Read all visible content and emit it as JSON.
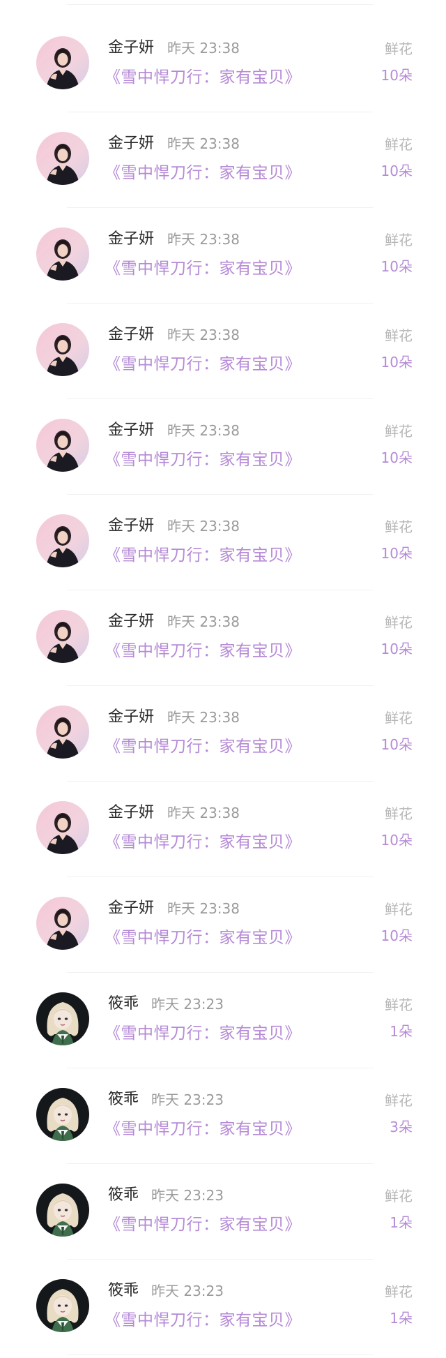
{
  "records": [
    {
      "avatar": "woman-portrait-pink-background",
      "user": "金子妍",
      "time": "昨天 23:38",
      "work": "《雪中悍刀行：家有宝贝》",
      "gift": "鲜花",
      "amount": "10朵"
    },
    {
      "avatar": "woman-portrait-pink-background",
      "user": "金子妍",
      "time": "昨天 23:38",
      "work": "《雪中悍刀行：家有宝贝》",
      "gift": "鲜花",
      "amount": "10朵"
    },
    {
      "avatar": "woman-portrait-pink-background",
      "user": "金子妍",
      "time": "昨天 23:38",
      "work": "《雪中悍刀行：家有宝贝》",
      "gift": "鲜花",
      "amount": "10朵"
    },
    {
      "avatar": "woman-portrait-pink-background",
      "user": "金子妍",
      "time": "昨天 23:38",
      "work": "《雪中悍刀行：家有宝贝》",
      "gift": "鲜花",
      "amount": "10朵"
    },
    {
      "avatar": "woman-portrait-pink-background",
      "user": "金子妍",
      "time": "昨天 23:38",
      "work": "《雪中悍刀行：家有宝贝》",
      "gift": "鲜花",
      "amount": "10朵"
    },
    {
      "avatar": "woman-portrait-pink-background",
      "user": "金子妍",
      "time": "昨天 23:38",
      "work": "《雪中悍刀行：家有宝贝》",
      "gift": "鲜花",
      "amount": "10朵"
    },
    {
      "avatar": "woman-portrait-pink-background",
      "user": "金子妍",
      "time": "昨天 23:38",
      "work": "《雪中悍刀行：家有宝贝》",
      "gift": "鲜花",
      "amount": "10朵"
    },
    {
      "avatar": "woman-portrait-pink-background",
      "user": "金子妍",
      "time": "昨天 23:38",
      "work": "《雪中悍刀行：家有宝贝》",
      "gift": "鲜花",
      "amount": "10朵"
    },
    {
      "avatar": "woman-portrait-pink-background",
      "user": "金子妍",
      "time": "昨天 23:38",
      "work": "《雪中悍刀行：家有宝贝》",
      "gift": "鲜花",
      "amount": "10朵"
    },
    {
      "avatar": "woman-portrait-pink-background",
      "user": "金子妍",
      "time": "昨天 23:38",
      "work": "《雪中悍刀行：家有宝贝》",
      "gift": "鲜花",
      "amount": "10朵"
    },
    {
      "avatar": "blonde-character-dark-background",
      "user": "筱乖",
      "time": "昨天 23:23",
      "work": "《雪中悍刀行：家有宝贝》",
      "gift": "鲜花",
      "amount": "1朵"
    },
    {
      "avatar": "blonde-character-dark-background",
      "user": "筱乖",
      "time": "昨天 23:23",
      "work": "《雪中悍刀行：家有宝贝》",
      "gift": "鲜花",
      "amount": "3朵"
    },
    {
      "avatar": "blonde-character-dark-background",
      "user": "筱乖",
      "time": "昨天 23:23",
      "work": "《雪中悍刀行：家有宝贝》",
      "gift": "鲜花",
      "amount": "1朵"
    },
    {
      "avatar": "blonde-character-dark-background",
      "user": "筱乖",
      "time": "昨天 23:23",
      "work": "《雪中悍刀行：家有宝贝》",
      "gift": "鲜花",
      "amount": "1朵"
    }
  ],
  "colors": {
    "accent": "#b58ad6",
    "name": "#2a2a2a",
    "muted": "#9a9a9a",
    "gift_label": "#b7b7b7",
    "divider": "#f1f1f1"
  }
}
